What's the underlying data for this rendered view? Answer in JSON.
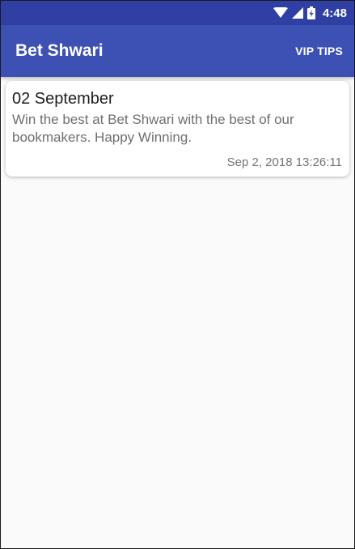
{
  "status_bar": {
    "time": "4:48",
    "icons": [
      "wifi-icon",
      "signal-icon",
      "battery-charging-icon"
    ]
  },
  "app_bar": {
    "title": "Bet Shwari",
    "action_label": "VIP TIPS"
  },
  "posts": [
    {
      "title": "02 September",
      "body": "Win the best at Bet Shwari with the best of our bookmakers. Happy Winning.",
      "timestamp": "Sep 2, 2018 13:26:11"
    }
  ],
  "colors": {
    "status_bar": "#2f3fa3",
    "app_bar": "#3d51b5",
    "background": "#fafafa",
    "card": "#ffffff"
  }
}
